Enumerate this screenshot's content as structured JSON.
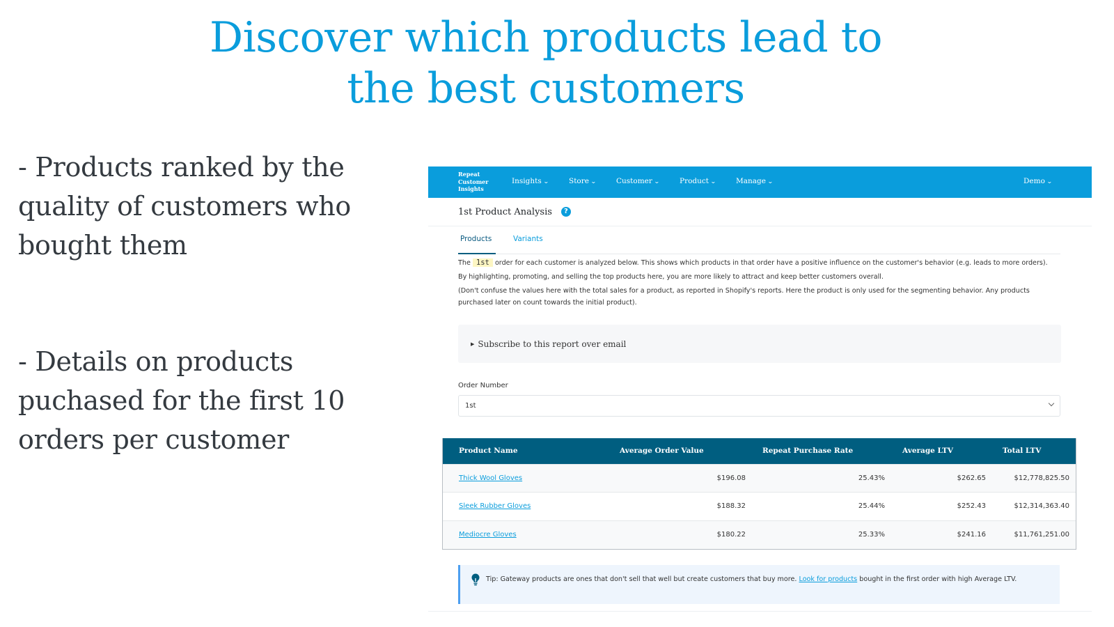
{
  "slide": {
    "headline_line1": "Discover which products lead to",
    "headline_line2": "the best customers",
    "bullets": [
      "- Products ranked by the quality of customers who bought them",
      "- Details on products puchased for the first 10 orders per customer"
    ],
    "accent_color": "#0a9ddc"
  },
  "app": {
    "navbar": {
      "brand_line1": "Repeat",
      "brand_line2": "Customer",
      "brand_line3": "Insights",
      "items": [
        {
          "label": "Insights",
          "icon": "chevron-down-icon"
        },
        {
          "label": "Store",
          "icon": "chevron-down-icon"
        },
        {
          "label": "Customer",
          "icon": "chevron-down-icon"
        },
        {
          "label": "Product",
          "icon": "chevron-down-icon"
        },
        {
          "label": "Manage",
          "icon": "chevron-down-icon"
        }
      ],
      "account": {
        "label": "Demo",
        "icon": "chevron-down-icon"
      },
      "background_color": "#0a9ddc"
    },
    "page_title": "1st Product Analysis",
    "help_icon_glyph": "?",
    "tabs": [
      {
        "label": "Products",
        "active": true
      },
      {
        "label": "Variants",
        "active": false
      }
    ],
    "description": {
      "p1_before": "The",
      "p1_code": "1st",
      "p1_after": "order for each customer is analyzed below. This shows which products in that order have a positive influence on the customer's behavior (e.g. leads to more orders).",
      "p2": "By highlighting, promoting, and selling the top products here, you are more likely to attract and keep better customers overall.",
      "p3": "(Don't confuse the values here with the total sales for a product, as reported in Shopify's reports. Here the product is only used for the segmenting behavior. Any products purchased later on count towards the initial product)."
    },
    "subscribe": {
      "label": "Subscribe to this report over email",
      "icon": "disclosure-triangle-icon"
    },
    "order_number": {
      "label": "Order Number",
      "selected": "1st"
    },
    "table": {
      "header_color": "#005e80",
      "columns": [
        "Product Name",
        "Average Order Value",
        "Repeat Purchase Rate",
        "Average LTV",
        "Total LTV"
      ],
      "rows": [
        {
          "product": "Thick Wool Gloves",
          "aov": "$196.08",
          "repeat_rate": "25.43%",
          "avg_ltv": "$262.65",
          "total_ltv": "$12,778,825.50"
        },
        {
          "product": "Sleek Rubber Gloves",
          "aov": "$188.32",
          "repeat_rate": "25.44%",
          "avg_ltv": "$252.43",
          "total_ltv": "$12,314,363.40"
        },
        {
          "product": "Mediocre Gloves",
          "aov": "$180.22",
          "repeat_rate": "25.33%",
          "avg_ltv": "$241.16",
          "total_ltv": "$11,761,251.00"
        }
      ]
    },
    "tip": {
      "icon": "lightbulb-icon",
      "text_before": "Tip: Gateway products are ones that don't sell that well but create customers that buy more.",
      "link": "Look for products",
      "text_after": "bought in the first order with high Average LTV."
    }
  }
}
